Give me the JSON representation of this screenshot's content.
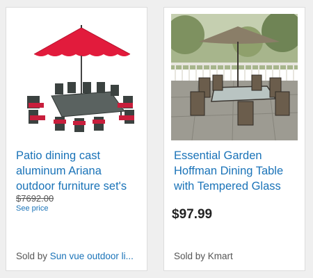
{
  "products": [
    {
      "title": "Patio dining cast aluminum Ariana outdoor furniture set's",
      "original_price": "$7692.00",
      "price_note": "See price",
      "sold_by_label": "Sold by ",
      "seller": "Sun vue outdoor li...",
      "umbrella_color": "#e21b3c",
      "cushion_color": "#c81e3c"
    },
    {
      "title": "Essential Garden Hoffman Dining Table with Tempered Glass",
      "price": "$97.99",
      "sold_by_label": "Sold by ",
      "seller": "Kmart"
    }
  ],
  "colors": {
    "link": "#1a73b8",
    "background": "#efefef"
  }
}
